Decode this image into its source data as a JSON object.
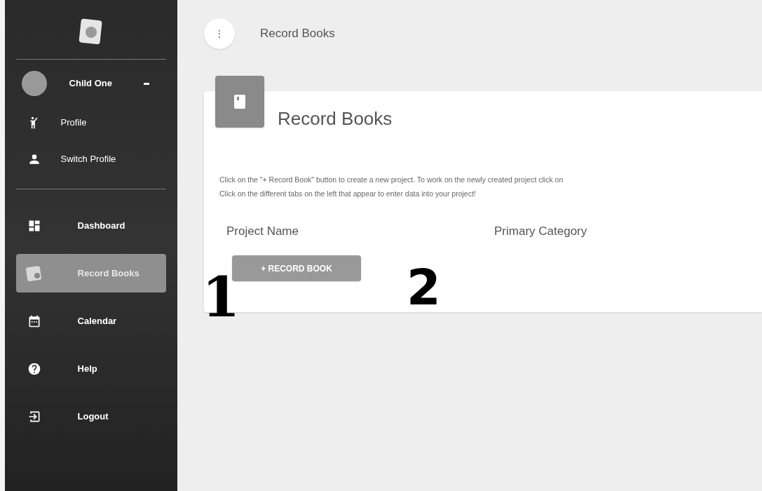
{
  "sidebar": {
    "user": {
      "name": "Child One",
      "expanded": true
    },
    "user_menu": [
      {
        "kind": "profile",
        "label": "Profile"
      },
      {
        "kind": "switch",
        "label": "Switch Profile"
      }
    ],
    "items": [
      {
        "kind": "dashboard",
        "label": "Dashboard",
        "selected": false
      },
      {
        "kind": "book",
        "label": "Record Books",
        "selected": true
      },
      {
        "kind": "calendar",
        "label": "Calendar",
        "selected": false
      },
      {
        "kind": "help",
        "label": "Help",
        "selected": false
      },
      {
        "kind": "logout",
        "label": "Logout",
        "selected": false
      }
    ]
  },
  "top_bar": {
    "menu_glyph": "⋮",
    "title": "Record Books"
  },
  "card": {
    "title": "Record Books",
    "description": [
      "Click on the \"+ Record Book\" button to create a new project. To work on the newly created project click on",
      "Click on the different tabs on the left that appear to enter data into your project!"
    ],
    "columns": [
      "Project Name",
      "Primary Category"
    ],
    "button": "+ RECORD BOOK"
  },
  "annotations": [
    "1",
    "2"
  ]
}
